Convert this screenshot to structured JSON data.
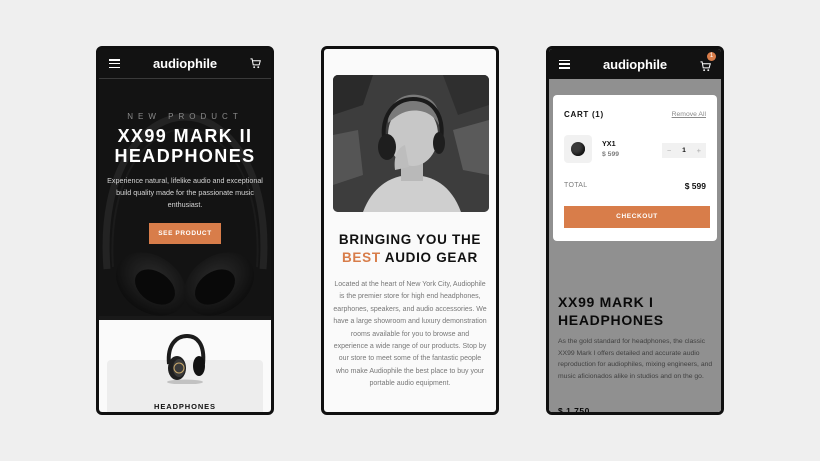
{
  "brand": {
    "logo": "audiophile",
    "accent": "#d87d4a"
  },
  "phone1": {
    "hero": {
      "kicker": "NEW PRODUCT",
      "title_line1": "XX99 MARK II",
      "title_line2": "HEADPHONES",
      "description": "Experience natural, lifelike audio and exceptional build quality made for the passionate music enthusiast.",
      "button": "SEE PRODUCT"
    },
    "category": {
      "label": "HEADPHONES"
    }
  },
  "phone2": {
    "heading_line1": "BRINGING YOU THE",
    "heading_accent": "BEST",
    "heading_rest": "AUDIO GEAR",
    "body": "Located at the heart of New York City, Audiophile is the premier store for high end headphones, earphones, speakers, and audio accessories. We have a large showroom and luxury demonstration rooms available for you to browse and experience a wide range of our products. Stop by our store to meet some of the fantastic people who make Audiophile the best place to buy your portable audio equipment."
  },
  "phone3": {
    "cart_badge": "1",
    "cart": {
      "title": "CART (1)",
      "remove_all": "Remove All",
      "item": {
        "name": "YX1",
        "price": "$ 599",
        "qty": "1",
        "minus": "−",
        "plus": "+"
      },
      "total_label": "TOTAL",
      "total_value": "$ 599",
      "checkout": "CHECKOUT"
    },
    "product": {
      "title_line1": "XX99 MARK I",
      "title_line2": "HEADPHONES",
      "description": "As the gold standard for headphones, the classic XX99 Mark I offers detailed and accurate audio reproduction for audiophiles, mixing engineers, and music aficionados alike in studios and on the go.",
      "price": "$ 1,750"
    }
  },
  "icons": [
    "hamburger-menu-icon",
    "cart-icon",
    "headphones-image",
    "portrait-photo"
  ]
}
